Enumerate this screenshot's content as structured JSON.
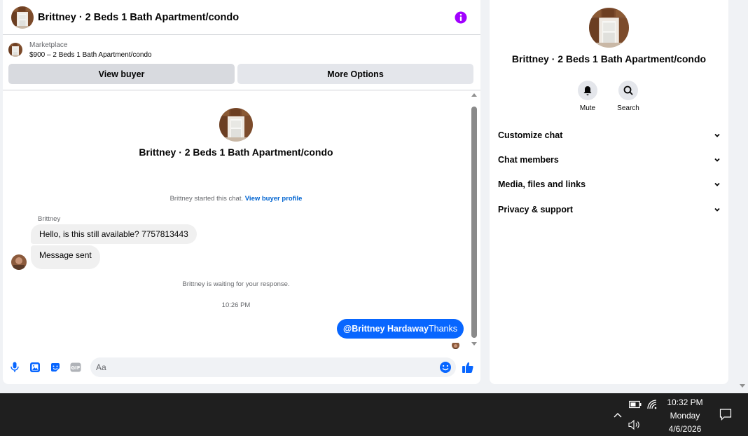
{
  "chat": {
    "title": "Brittney · 2 Beds 1 Bath Apartment/condo",
    "listing_label": "Marketplace",
    "listing_price": "$900 – 2 Beds 1 Bath Apartment/condo",
    "view_buyer_label": "View buyer",
    "more_options_label": "More Options",
    "conversation_title": "Brittney · 2 Beds 1 Bath Apartment/condo",
    "started_note": "Brittney started this chat.",
    "view_profile_link": "View buyer profile",
    "sender_name": "Brittney",
    "messages": [
      {
        "text": "Hello, is this still available? 7757813443"
      },
      {
        "text": "Message sent"
      }
    ],
    "waiting_note": "Brittney is waiting for your response.",
    "timestamp": "10:26 PM",
    "outgoing": {
      "mention": "@Brittney Hardaway",
      "text": "Thanks"
    },
    "input_placeholder": "Aa",
    "accent_color": "#0866ff"
  },
  "info": {
    "title": "Brittney · 2 Beds 1 Bath Apartment/condo",
    "actions": [
      {
        "label": "Mute",
        "icon": "bell-icon"
      },
      {
        "label": "Search",
        "icon": "search-icon"
      }
    ],
    "sections": [
      {
        "label": "Customize chat"
      },
      {
        "label": "Chat members"
      },
      {
        "label": "Media, files and links"
      },
      {
        "label": "Privacy & support"
      }
    ]
  },
  "taskbar": {
    "time": "10:32 PM",
    "day": "Monday",
    "date": "4/6/2026"
  },
  "colors": {
    "info_icon": "#a100ff",
    "tool_icons": "#0866ff",
    "taskbar": "#1f1f1f"
  }
}
